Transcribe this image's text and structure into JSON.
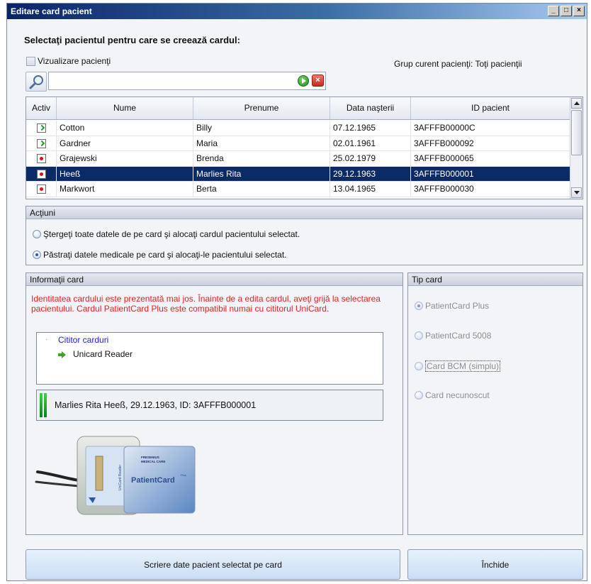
{
  "window": {
    "title": "Editare card pacient",
    "controls": [
      "_",
      "□",
      "×"
    ]
  },
  "heading": "Selectaţi pacientul pentru care se creează cardul:",
  "view_patients_label": "Vizualizare pacienţi",
  "group_label": "Grup curent pacienţi: Toţi pacienţii",
  "search": {
    "value": "",
    "placeholder": ""
  },
  "table": {
    "columns": [
      "Activ",
      "Nume",
      "Prenume",
      "Data naşterii",
      "ID pacient"
    ],
    "rows": [
      {
        "status": "active",
        "nume": "Cotton",
        "prenume": "Billy",
        "data": "07.12.1965",
        "id": "3AFFFB00000C",
        "selected": false
      },
      {
        "status": "active",
        "nume": "Gardner",
        "prenume": "Maria",
        "data": "02.01.1961",
        "id": "3AFFFB000092",
        "selected": false
      },
      {
        "status": "inactive",
        "nume": "Grajewski",
        "prenume": "Brenda",
        "data": "25.02.1979",
        "id": "3AFFFB000065",
        "selected": false
      },
      {
        "status": "inactive",
        "nume": "Heeß",
        "prenume": "Marlies Rita",
        "data": "29.12.1963",
        "id": "3AFFFB000001",
        "selected": true
      },
      {
        "status": "inactive",
        "nume": "Markwort",
        "prenume": "Berta",
        "data": "13.04.1965",
        "id": "3AFFFB000030",
        "selected": false
      }
    ]
  },
  "actions": {
    "title": "Acţiuni",
    "options": [
      {
        "label": "Ştergeţi toate datele de pe card şi alocaţi cardul pacientului selectat.",
        "checked": false
      },
      {
        "label": "Păstraţi datele medicale pe card şi alocaţi-le pacientului selectat.",
        "checked": true
      }
    ]
  },
  "card_info": {
    "title": "Informaţii card",
    "warning": "Identitatea cardului este prezentată mai jos. Înainte de a edita cardul, aveţi grijă la selectarea pacientului. Cardul PatientCard Plus este compatibil numai cu cititorul UniCard.",
    "tree_root": "Cititor carduri",
    "tree_child": "Unicard Reader",
    "card_identity": "Marlies Rita Heeß, 29.12.1963, ID: 3AFFFB000001",
    "image_text": {
      "brand_top": "FRESENIUS",
      "brand_bottom": "MEDICAL CARE",
      "card_name": "PatientCard",
      "card_plus": "Plus",
      "reader_label": "UniCard Reader"
    }
  },
  "card_type": {
    "title": "Tip card",
    "options": [
      {
        "label": "PatientCard Plus",
        "checked": true
      },
      {
        "label": "PatientCard 5008",
        "checked": false
      },
      {
        "label": "Card BCM (simplu)",
        "checked": false
      },
      {
        "label": "Card necunoscut",
        "checked": false
      }
    ]
  },
  "buttons": {
    "write": "Scriere date pacient selectat pe card",
    "close": "Închide"
  }
}
